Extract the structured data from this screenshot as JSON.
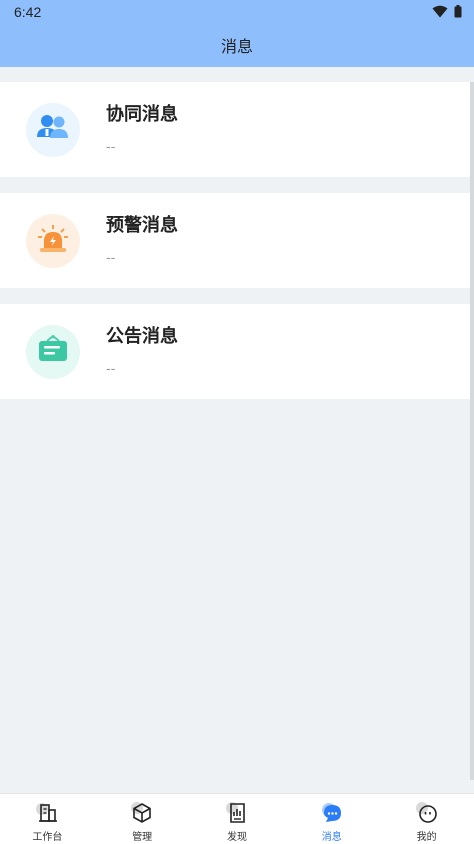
{
  "status": {
    "time": "6:42"
  },
  "nav": {
    "title": "消息"
  },
  "messages": [
    {
      "title": "协同消息",
      "subtitle": "--",
      "icon": "collaboration-users-icon",
      "bg": "#eaf5fd"
    },
    {
      "title": "预警消息",
      "subtitle": "--",
      "icon": "alarm-light-icon",
      "bg": "#fdf0e2"
    },
    {
      "title": "公告消息",
      "subtitle": "--",
      "icon": "notice-board-icon",
      "bg": "#e4f8f4"
    }
  ],
  "tabs": [
    {
      "label": "工作台",
      "icon": "building-icon",
      "active": false
    },
    {
      "label": "管理",
      "icon": "box-icon",
      "active": false
    },
    {
      "label": "发现",
      "icon": "report-icon",
      "active": false
    },
    {
      "label": "消息",
      "icon": "chat-bubble-icon",
      "active": true
    },
    {
      "label": "我的",
      "icon": "face-icon",
      "active": false
    }
  ],
  "colors": {
    "header": "#8fbefc",
    "background": "#eff2f4",
    "accent": "#2b7cf7"
  }
}
